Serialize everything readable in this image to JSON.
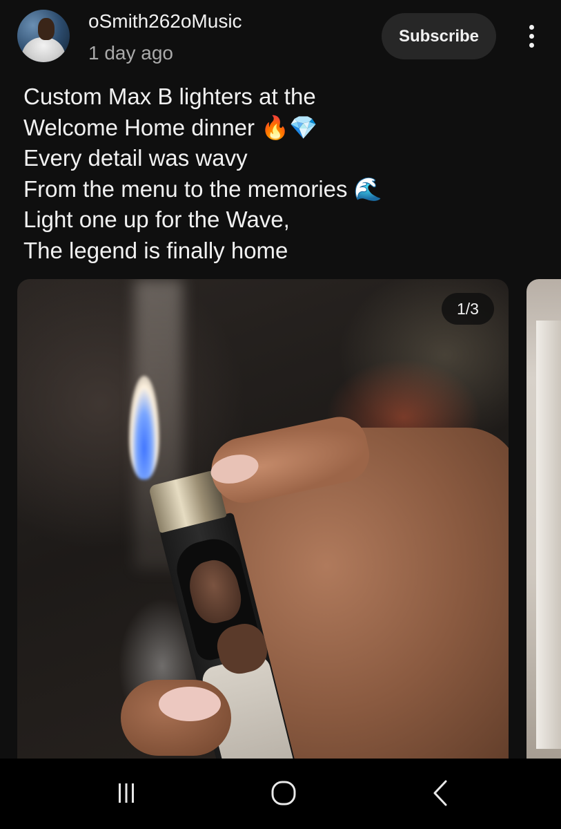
{
  "post": {
    "channel_name": "oSmith262oMusic",
    "time": "1 day ago",
    "subscribe_label": "Subscribe",
    "more_icon": "more-vert-icon",
    "text_lines": [
      "Custom Max B lighters at the",
      "Welcome Home dinner 🔥💎",
      "Every detail was wavy",
      "From the menu to the memories 🌊",
      "Light one up for the Wave,",
      "The legend is finally home"
    ],
    "image": {
      "page_indicator": "1/3",
      "current_page": 1,
      "total_pages": 3
    }
  },
  "nav": {
    "recents_icon": "recents-icon",
    "home_icon": "home-icon",
    "back_icon": "back-icon"
  },
  "colors": {
    "background": "#0f0f0f",
    "subscribe_bg": "#272727",
    "text_primary": "#f1f1f1",
    "text_secondary": "#aaaaaa",
    "nav_bg": "#000000"
  }
}
